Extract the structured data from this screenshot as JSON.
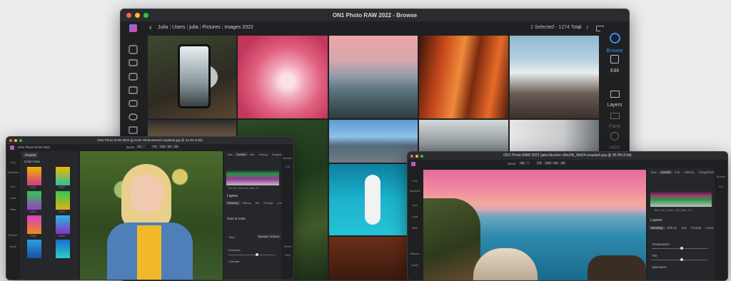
{
  "main_window": {
    "title": "ON1 Photo RAW 2022 - Browse",
    "breadcrumb": [
      "Julia",
      "Users",
      "julia",
      "Pictures",
      "Images 2022"
    ],
    "selection_status": "1 Selected - 1274 Total",
    "modules": [
      {
        "label": "Browse",
        "icon": "browse-icon"
      },
      {
        "label": "Edit",
        "icon": "edit-icon"
      },
      {
        "label": "Layers",
        "icon": "layers-icon"
      },
      {
        "label": "Pano",
        "icon": "pano-icon"
      },
      {
        "label": "HDR",
        "icon": "hdr-icon"
      }
    ],
    "accent_color": "#3d8bff"
  },
  "left_window": {
    "title": "ON1 Photo RAW 2022 (jj-meier-0hahva54wd-unsplash.jpg @ 41.0% 8-bit)",
    "app_label": "ON1 Photo RAW 2022",
    "presets_button": "Presets",
    "section": "Color Fuse",
    "zoom_label": "Zoom",
    "zoom_value": "41",
    "fit_buttons": [
      "Fit",
      "100",
      "50",
      "25"
    ],
    "panel_tabs": [
      "Nav",
      "Levels",
      "Info",
      "History",
      "Snapshots"
    ],
    "histogram_readout": "Red: 20 | Green: 82 | Blue: 64",
    "layers_label": "Layers",
    "subtabs": [
      "Develop",
      "Effects",
      "Me",
      "Portrait",
      "Local"
    ],
    "tone_color": "Tone & Color",
    "tone_label": "Tone",
    "mode_buttons": [
      "Manual",
      "AI Auto"
    ],
    "slider_labels": [
      "Exposure",
      "Contrast"
    ],
    "swatch_labels": [
      "CT11",
      "CT12",
      "CT13",
      "CT14",
      "CT15",
      "CT16"
    ],
    "tool_labels": [
      "Crop",
      "Transform",
      "Text",
      "Local",
      "Mask",
      "Retouch",
      "Clarify"
    ],
    "right_buttons": [
      "Browse",
      "Edit"
    ],
    "bottom_buttons": [
      "Revert",
      "Copy"
    ]
  },
  "right_window": {
    "title": "ON1 Photo RAW 2022 (jake-blucker-c8m1fkl_Wd24-unsplash.jpg @ 36.0% 8-bit)",
    "zoom_label": "Zoom",
    "zoom_value": "36",
    "fit_buttons": [
      "Fit",
      "100",
      "50",
      "25"
    ],
    "panel_tabs": [
      "Nav",
      "Levels",
      "Info",
      "History",
      "Snapshots"
    ],
    "histogram_readout": "Red: 252 | Green: 153 | Blue: 141",
    "layers_label": "Layers",
    "subtabs": [
      "Develop",
      "Effects",
      "Sky",
      "Portrait",
      "Local"
    ],
    "slider_labels": [
      "Temperature",
      "Tint",
      "Saturation"
    ],
    "tool_labels": [
      "Crop",
      "Transform",
      "Text",
      "Local",
      "Mask",
      "Retouch",
      "Clarify"
    ],
    "right_buttons": [
      "Browse",
      "Edit"
    ]
  }
}
